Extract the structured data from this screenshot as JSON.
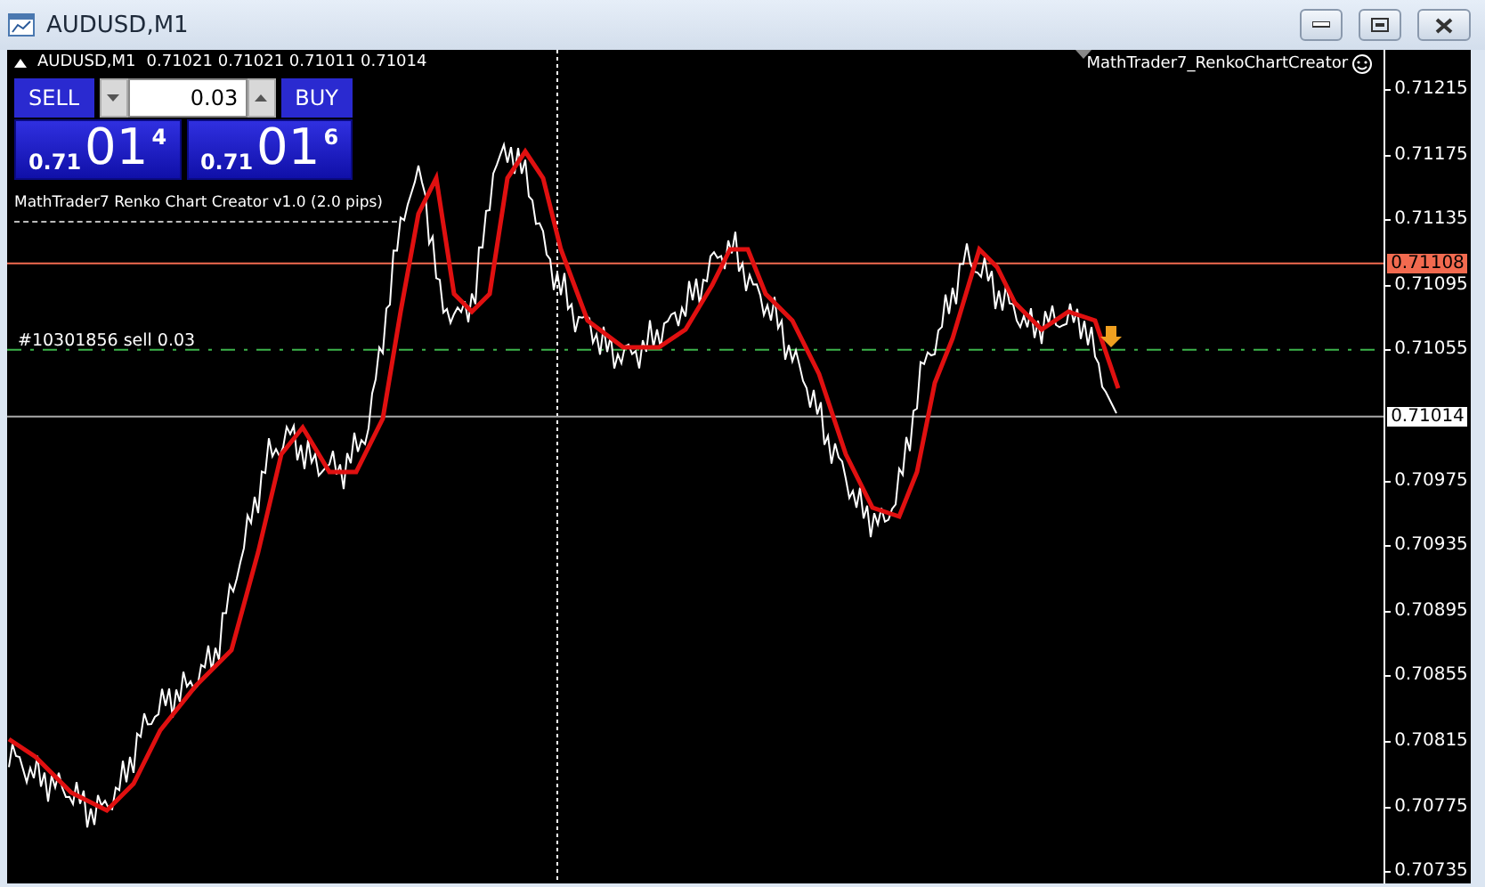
{
  "window": {
    "title": "AUDUSD,M1"
  },
  "chart": {
    "header": {
      "symbol": "AUDUSD,M1",
      "ohlc": "0.71021 0.71021 0.71011 0.71014"
    },
    "expert": "MathTrader7_RenkoChartCreator",
    "trade_panel": {
      "sell_label": "SELL",
      "buy_label": "BUY",
      "lot": "0.03",
      "bid": {
        "prefix": "0.71",
        "big": "01",
        "small": "4"
      },
      "ask": {
        "prefix": "0.71",
        "big": "01",
        "small": "6"
      },
      "caption": "MathTrader7 Renko Chart Creator v1.0 (2.0 pips)"
    },
    "order_label": "#10301856 sell 0.03",
    "price_axis": [
      "0.71215",
      "0.71175",
      "0.71135",
      "0.71095",
      "0.71055",
      "0.70975",
      "0.70935",
      "0.70895",
      "0.70855",
      "0.70815",
      "0.70775",
      "0.70735"
    ],
    "price_tags": [
      {
        "text": "0.71108",
        "color": "#f26a4f"
      },
      {
        "text": "0.71014",
        "color": "#ffffff"
      }
    ]
  }
}
